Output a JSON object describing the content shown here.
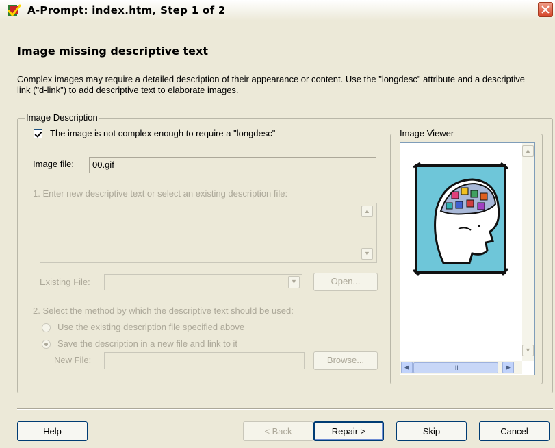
{
  "window": {
    "title": "A-Prompt: index.htm, Step 1 of 2"
  },
  "heading": "Image missing descriptive text",
  "description": "Complex images may require a detailed description of their appearance or content.  Use the \"longdesc\" attribute and a descriptive link (\"d-link\") to add descriptive text to elaborate images.",
  "image_description": {
    "legend": "Image Description",
    "checkbox_label": "The image is not complex enough to require a \"longdesc\"",
    "checkbox_checked": true,
    "image_file_label": "Image file:",
    "image_file_value": "00.gif",
    "step1_label": "1. Enter new descriptive text or select an existing description file:",
    "existing_file_label": "Existing File:",
    "open_button": "Open...",
    "step2_label": "2. Select the method by which the descriptive text should be used:",
    "radio_use_existing": "Use the existing description file specified above",
    "radio_save_new": "Save the description in a new file and link to it",
    "new_file_label": "New File:",
    "browse_button": "Browse..."
  },
  "image_viewer": {
    "legend": "Image Viewer",
    "hscroll_grip": "III"
  },
  "buttons": {
    "help": "Help",
    "back": "< Back",
    "repair": "Repair >",
    "skip": "Skip",
    "cancel": "Cancel"
  },
  "icons": {
    "up_arrow": "▲",
    "down_arrow": "▼",
    "left_arrow": "◀",
    "right_arrow": "▶",
    "dropdown": "▼"
  }
}
